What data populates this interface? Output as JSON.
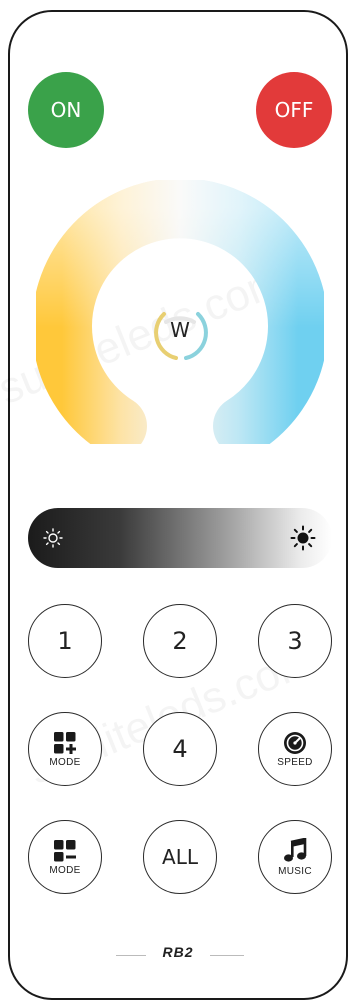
{
  "power": {
    "on_label": "ON",
    "off_label": "OFF",
    "on_color": "#3aa24a",
    "off_color": "#e23a3a"
  },
  "color_wheel": {
    "center_label": "W",
    "warm_color": "#ffc735",
    "cool_color": "#6fd0f0"
  },
  "brightness": {
    "low_icon": "sun-low-icon",
    "high_icon": "sun-high-icon"
  },
  "buttons": {
    "b1": "1",
    "b2": "2",
    "b3": "3",
    "b4": "4",
    "mode_plus": "MODE",
    "speed": "SPEED",
    "mode_minus": "MODE",
    "all": "ALL",
    "music": "MUSIC"
  },
  "brand": "RB2",
  "watermark": "sunliteleds.com"
}
